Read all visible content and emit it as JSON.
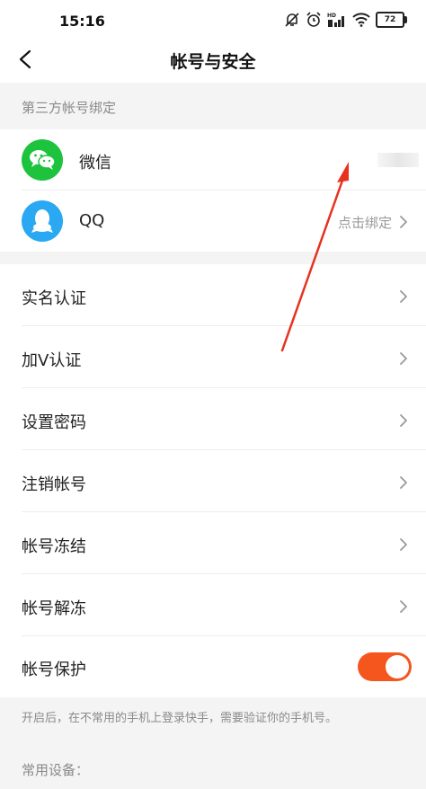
{
  "status_bar": {
    "time": "15:16",
    "battery": "72",
    "icons": [
      "mute-bell-icon",
      "alarm-icon",
      "hd-signal-icon",
      "wifi-icon",
      "battery-icon"
    ]
  },
  "nav": {
    "title": "帐号与安全",
    "back_icon": "chevron-left-icon"
  },
  "third_party": {
    "header": "第三方帐号绑定",
    "items": [
      {
        "label": "微信",
        "icon": "wechat-icon",
        "color": "#1ec33d",
        "value": ""
      },
      {
        "label": "QQ",
        "icon": "qq-icon",
        "color": "#2aa8f2",
        "value": "点击绑定"
      }
    ]
  },
  "settings": {
    "items": [
      {
        "label": "实名认证"
      },
      {
        "label": "加V认证"
      },
      {
        "label": "设置密码"
      },
      {
        "label": "注销帐号"
      },
      {
        "label": "帐号冻结"
      },
      {
        "label": "帐号解冻"
      }
    ],
    "protect": {
      "label": "帐号保护",
      "enabled": true,
      "toggle_color": "#f5561e"
    },
    "protect_hint": "开启后，在不常用的手机上登录快手，需要验证你的手机号。"
  },
  "devices": {
    "header": "常用设备："
  },
  "colors": {
    "background": "#f4f4f4",
    "annotation_arrow": "#e8321f"
  }
}
